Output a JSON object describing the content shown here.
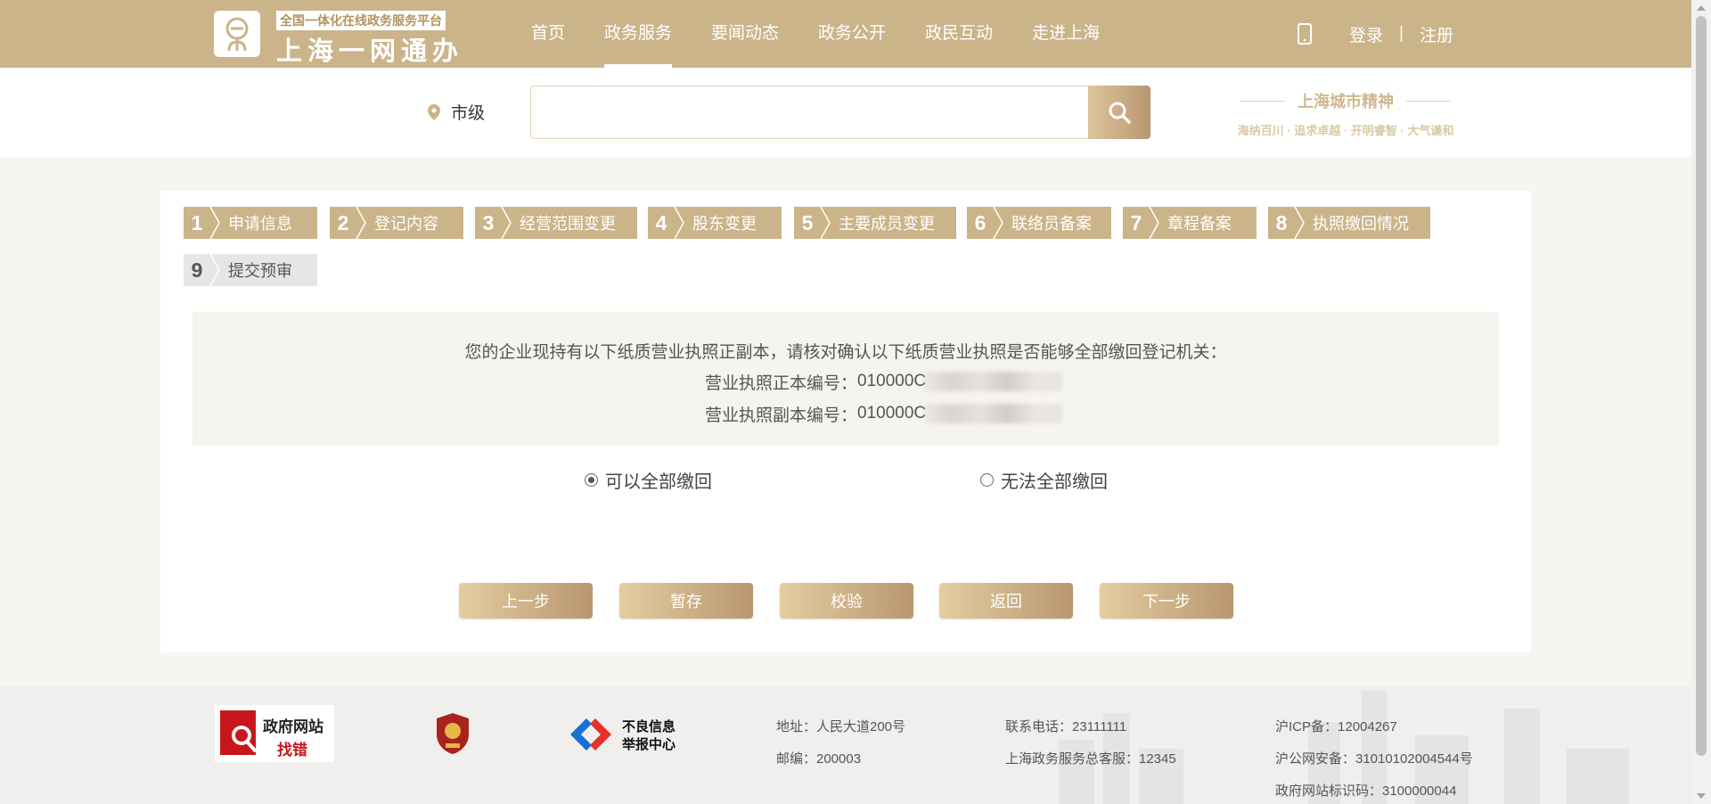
{
  "header": {
    "logo_tag": "全国一体化在线政务服务平台",
    "logo_name": "上海一网通办",
    "nav": [
      "首页",
      "政务服务",
      "要闻动态",
      "政务公开",
      "政民互动",
      "走进上海"
    ],
    "active_nav": "政务服务",
    "login": "登录",
    "separator": "|",
    "register": "注册"
  },
  "search": {
    "region": "市级",
    "placeholder": "",
    "spirit_title": "上海城市精神",
    "spirit_sub": "海纳百川 · 追求卓越 · 开明睿智 · 大气谦和"
  },
  "steps": [
    {
      "num": "1",
      "label": "申请信息",
      "active": true
    },
    {
      "num": "2",
      "label": "登记内容",
      "active": true
    },
    {
      "num": "3",
      "label": "经营范围变更",
      "active": true
    },
    {
      "num": "4",
      "label": "股东变更",
      "active": true
    },
    {
      "num": "5",
      "label": "主要成员变更",
      "active": true
    },
    {
      "num": "6",
      "label": "联络员备案",
      "active": true
    },
    {
      "num": "7",
      "label": "章程备案",
      "active": true
    },
    {
      "num": "8",
      "label": "执照缴回情况",
      "active": true
    },
    {
      "num": "9",
      "label": "提交预审",
      "active": false
    }
  ],
  "notice": {
    "line1": "您的企业现持有以下纸质营业执照正副本，请核对确认以下纸质营业执照是否能够全部缴回登记机关：",
    "original_label": "营业执照正本编号：",
    "original_value": "010000C",
    "copy_label": "营业执照副本编号：",
    "copy_value": "010000C"
  },
  "options": {
    "can_return": "可以全部缴回",
    "cannot_return": "无法全部缴回",
    "selected": "can_return"
  },
  "buttons": {
    "prev": "上一步",
    "save": "暂存",
    "verify": "校验",
    "back": "返回",
    "next": "下一步"
  },
  "footer": {
    "badge1_top": "政府网站",
    "badge1_bottom": "找错",
    "badge3_top": "不良信息",
    "badge3_bottom": "举报中心",
    "address": "地址：人民大道200号",
    "postcode": "邮编：200003",
    "phone": "联系电话：23111111",
    "hotline": "上海政务服务总客服：12345",
    "icp": "沪ICP备：12004267",
    "security": "沪公网安备：31010102004544号",
    "site_code": "政府网站标识码：3100000044"
  },
  "colors": {
    "brand": "#cbb48a",
    "button_start": "#e3ce9f",
    "button_end": "#b99670"
  }
}
